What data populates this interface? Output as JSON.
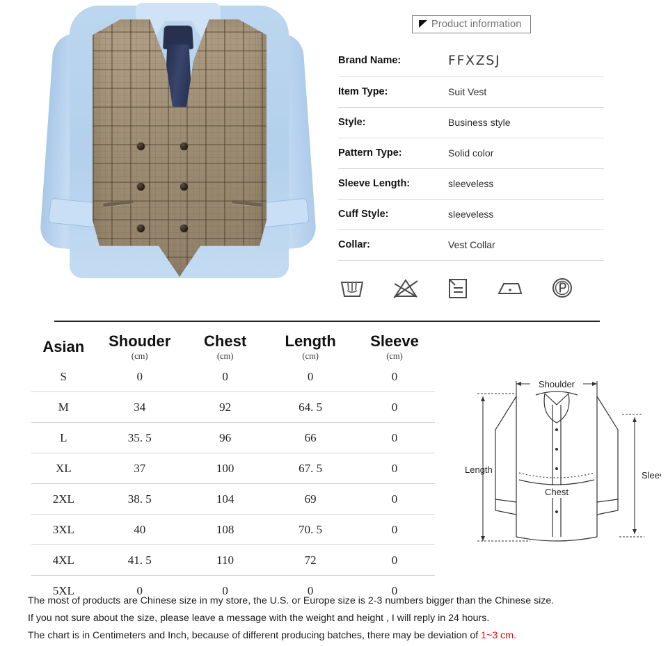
{
  "header": {
    "badge_label": "Product information",
    "badge_icon": "flag-icon"
  },
  "spec": {
    "rows": [
      {
        "label": "Brand Name:",
        "value": "FFXZSJ",
        "emphasis": true
      },
      {
        "label": "Item Type:",
        "value": "Suit Vest"
      },
      {
        "label": "Style:",
        "value": "Business style"
      },
      {
        "label": "Pattern Type:",
        "value": "Solid color"
      },
      {
        "label": "Sleeve Length:",
        "value": "sleeveless"
      },
      {
        "label": "Cuff Style:",
        "value": "sleeveless"
      },
      {
        "label": "Collar:",
        "value": "Vest Collar"
      }
    ]
  },
  "care_symbols": [
    {
      "name": "hand-wash-icon",
      "meaning": "Hand wash"
    },
    {
      "name": "do-not-bleach-icon",
      "meaning": "Do not bleach"
    },
    {
      "name": "tumble-dry-icon",
      "meaning": "Dry flat / drying"
    },
    {
      "name": "iron-low-heat-icon",
      "meaning": "Iron low heat"
    },
    {
      "name": "dry-clean-p-icon",
      "meaning": "Dry clean, P"
    }
  ],
  "size_chart": {
    "columns": [
      {
        "label": "Asian",
        "unit": ""
      },
      {
        "label": "Shouder",
        "unit": "(cm)"
      },
      {
        "label": "Chest",
        "unit": "(cm)"
      },
      {
        "label": "Length",
        "unit": "(cm)"
      },
      {
        "label": "Sleeve",
        "unit": "(cm)"
      }
    ],
    "rows": [
      [
        "S",
        "0",
        "0",
        "0",
        "0"
      ],
      [
        "M",
        "34",
        "92",
        "64. 5",
        "0"
      ],
      [
        "L",
        "35. 5",
        "96",
        "66",
        "0"
      ],
      [
        "XL",
        "37",
        "100",
        "67. 5",
        "0"
      ],
      [
        "2XL",
        "38. 5",
        "104",
        "69",
        "0"
      ],
      [
        "3XL",
        "40",
        "108",
        "70. 5",
        "0"
      ],
      [
        "4XL",
        "41. 5",
        "110",
        "72",
        "0"
      ],
      [
        "5XL",
        "0",
        "0",
        "0",
        "0"
      ]
    ]
  },
  "diagram": {
    "labels": {
      "shoulder": "Shoulder",
      "length": "Length",
      "chest": "Chest",
      "sleeve": "Sleeve"
    }
  },
  "notes": {
    "line1": "The most of products are Chinese size in my store, the U.S. or Europe size is 2-3 numbers bigger than the Chinese size.",
    "line2": "If you not sure about the size, please leave a message with the weight and height , I will reply in 24 hours.",
    "line3_prefix": "The chart is in Centimeters and Inch, because of different producing batches, there may be deviation of ",
    "line3_red": "1~3 cm.",
    "red_color": "#ff0000"
  },
  "product_photo": {
    "alt": "Man wearing beige plaid double-breasted suit vest over light blue shirt with navy tie",
    "colors": {
      "vest": "#9d8d74",
      "shirt": "#bcd6ef",
      "tie": "#27304e"
    }
  }
}
